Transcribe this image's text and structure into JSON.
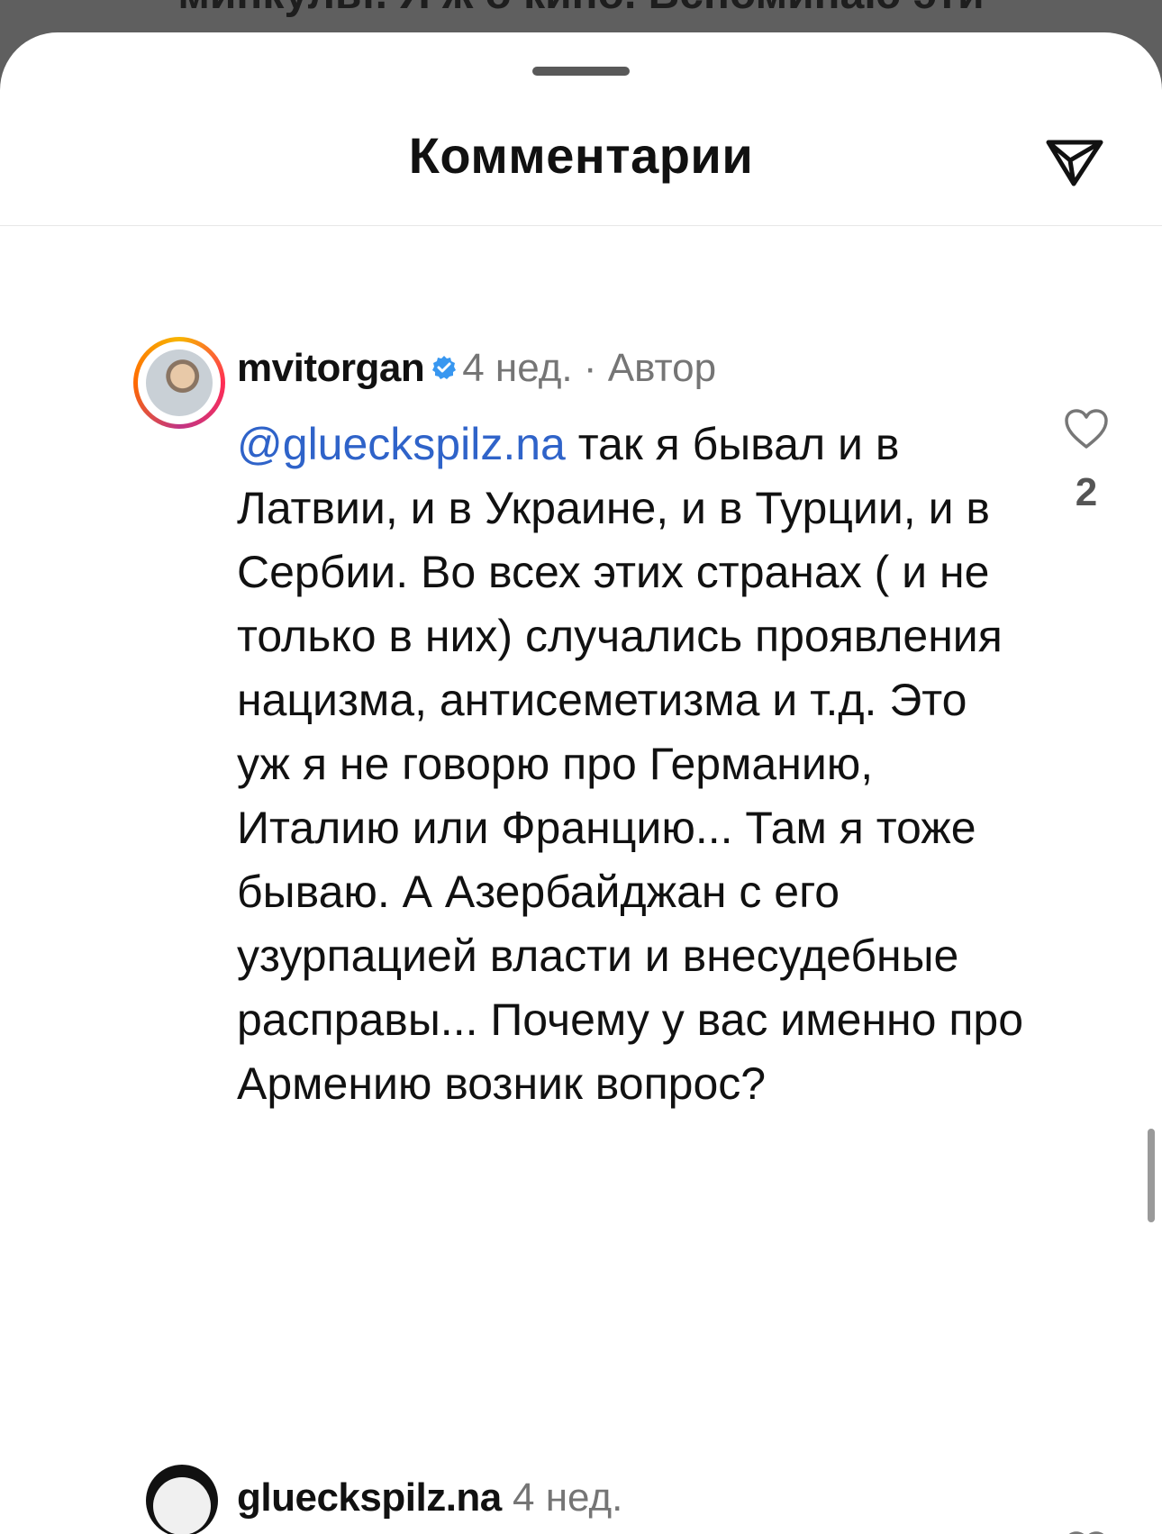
{
  "background_post_text": "минкульт. Я ж о кино. Вспоминаю эти",
  "sheet": {
    "title": "Комментарии",
    "share_icon": "send-paper-plane-icon"
  },
  "comments": [
    {
      "username": "mvitorgan",
      "verified": true,
      "time": "4 нед.",
      "separator": "·",
      "author_label": "Автор",
      "mention": "@glueckspilz.na",
      "text": " так я бывал и в Латвии, и в Украине, и в Турции, и в Сербии. Во всех этих странах ( и не только в них) случались проявления нацизма, антисеметизма и т.д. Это уж я не говорю про Германию, Италию или Францию... Там я тоже бываю. А Азербайджан с его узурпацией власти и внесудебные расправы... Почему у вас именно про Армению возник вопрос?",
      "likes": "2",
      "like_icon": "heart-outline-icon"
    },
    {
      "username": "glueckspilz.na",
      "time": "4 нед.",
      "like_icon": "heart-outline-icon"
    }
  ],
  "colors": {
    "mention": "#2f63c9",
    "muted": "#757575",
    "verified": "#3897f0"
  }
}
